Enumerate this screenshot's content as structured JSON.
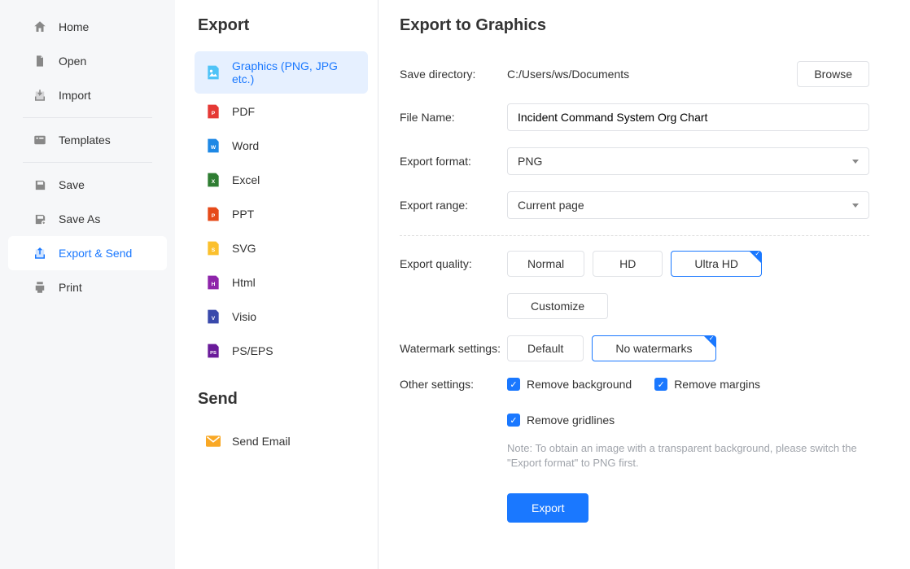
{
  "sidebar": {
    "items": [
      {
        "label": "Home"
      },
      {
        "label": "Open"
      },
      {
        "label": "Import"
      },
      {
        "label": "Templates"
      },
      {
        "label": "Save"
      },
      {
        "label": "Save As"
      },
      {
        "label": "Export & Send"
      },
      {
        "label": "Print"
      }
    ]
  },
  "middle": {
    "export_title": "Export",
    "send_title": "Send",
    "export_items": [
      {
        "label": "Graphics (PNG, JPG etc.)"
      },
      {
        "label": "PDF"
      },
      {
        "label": "Word"
      },
      {
        "label": "Excel"
      },
      {
        "label": "PPT"
      },
      {
        "label": "SVG"
      },
      {
        "label": "Html"
      },
      {
        "label": "Visio"
      },
      {
        "label": "PS/EPS"
      }
    ],
    "send_items": [
      {
        "label": "Send Email"
      }
    ]
  },
  "main": {
    "title": "Export to Graphics",
    "save_dir_label": "Save directory:",
    "save_dir_value": "C:/Users/ws/Documents",
    "browse_label": "Browse",
    "filename_label": "File Name:",
    "filename_value": "Incident Command System Org Chart",
    "format_label": "Export format:",
    "format_value": "PNG",
    "range_label": "Export range:",
    "range_value": "Current page",
    "quality_label": "Export quality:",
    "quality_options": [
      "Normal",
      "HD",
      "Ultra HD"
    ],
    "customize_label": "Customize",
    "watermark_label": "Watermark settings:",
    "watermark_options": [
      "Default",
      "No watermarks"
    ],
    "other_label": "Other settings:",
    "other_options": [
      "Remove background",
      "Remove margins",
      "Remove gridlines"
    ],
    "note": "Note: To obtain an image with a transparent background, please switch the \"Export format\" to PNG first.",
    "export_btn": "Export"
  }
}
